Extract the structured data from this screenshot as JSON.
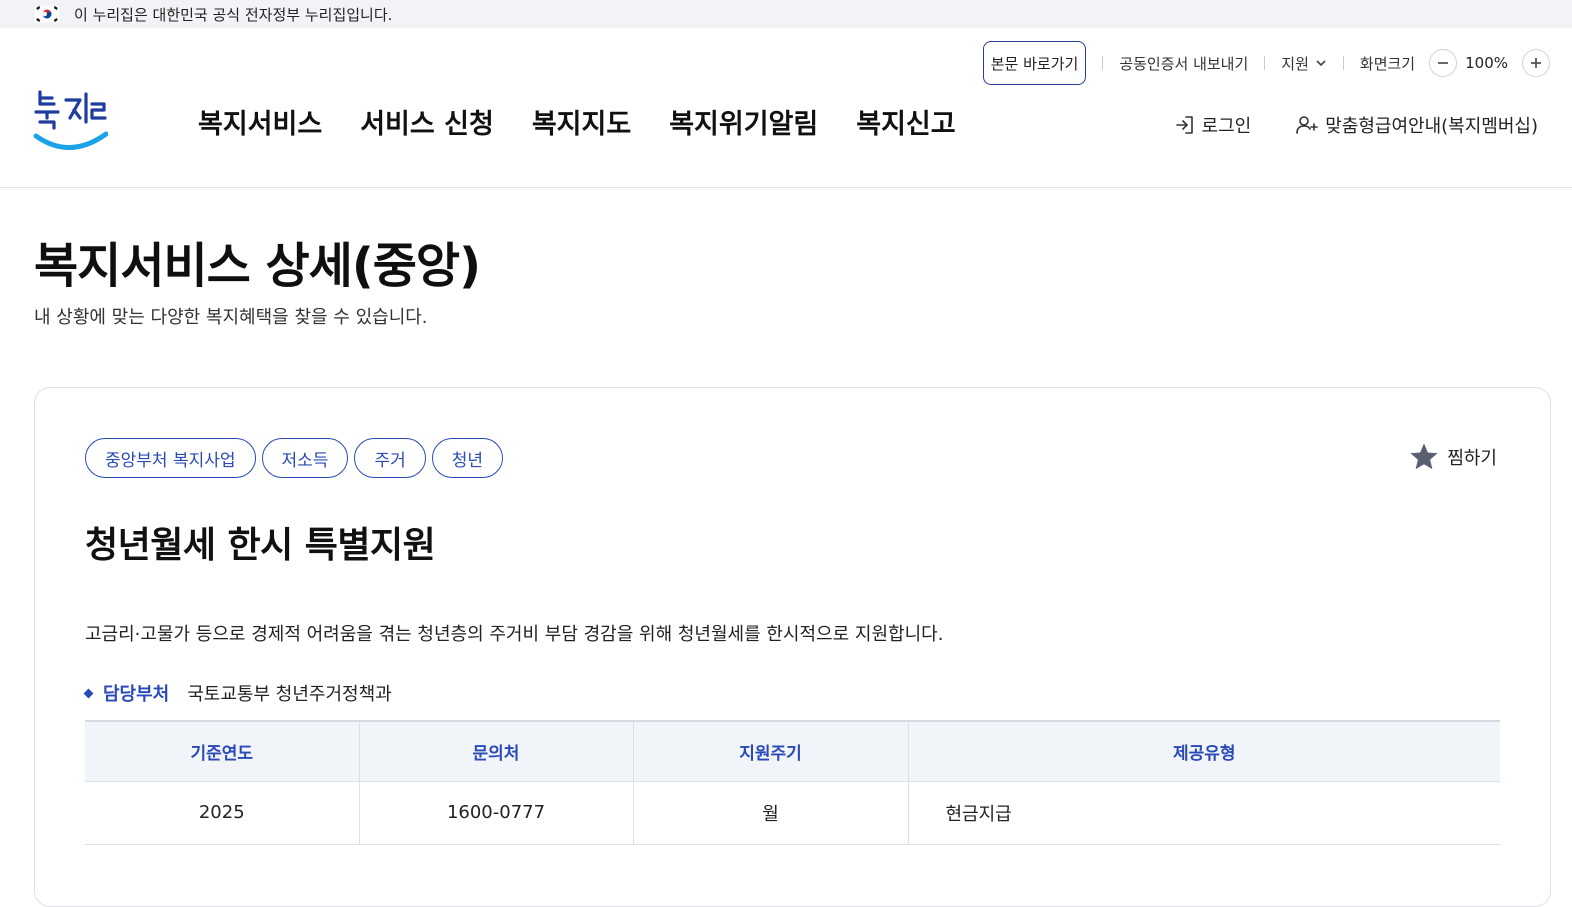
{
  "gov_banner": {
    "text": "이 누리집은 대한민국 공식 전자정부 누리집입니다."
  },
  "util": {
    "skip_link": "본문 바로가기",
    "cert_export": "공동인증서 내보내기",
    "support": "지원",
    "font_size_label": "화면크기",
    "zoom_value": "100%"
  },
  "logo": {
    "alt_text": "복지로"
  },
  "gnb": {
    "items": [
      {
        "label": "복지서비스"
      },
      {
        "label": "서비스 신청"
      },
      {
        "label": "복지지도"
      },
      {
        "label": "복지위기알림"
      },
      {
        "label": "복지신고"
      }
    ]
  },
  "auth": {
    "login": "로그인",
    "membership": "맞춤형급여안내(복지멤버십)"
  },
  "page": {
    "title": "복지서비스 상세(중앙)",
    "description": "내 상황에 맞는 다양한 복지혜택을 찾을 수 있습니다."
  },
  "service": {
    "tags": [
      "중앙부처 복지사업",
      "저소득",
      "주거",
      "청년"
    ],
    "bookmark_label": "찜하기",
    "title": "청년월세 한시 특별지원",
    "description": "고금리·고물가 등으로 경제적 어려움을 겪는 청년층의 주거비 부담 경감을 위해 청년월세를 한시적으로 지원합니다.",
    "dept_label": "담당부처",
    "dept_value": "국토교통부 청년주거정책과",
    "table": {
      "headers": [
        "기준연도",
        "문의처",
        "지원주기",
        "제공유형"
      ],
      "row": [
        "2025",
        "1600-0777",
        "월",
        "현금지급"
      ]
    }
  },
  "colors": {
    "accent": "#2a4ab8",
    "logo_blue": "#1aa3e8",
    "logo_navy": "#1f3c9e",
    "banner_bg": "#f1f3f7",
    "table_header_bg": "#f1f4f9"
  }
}
